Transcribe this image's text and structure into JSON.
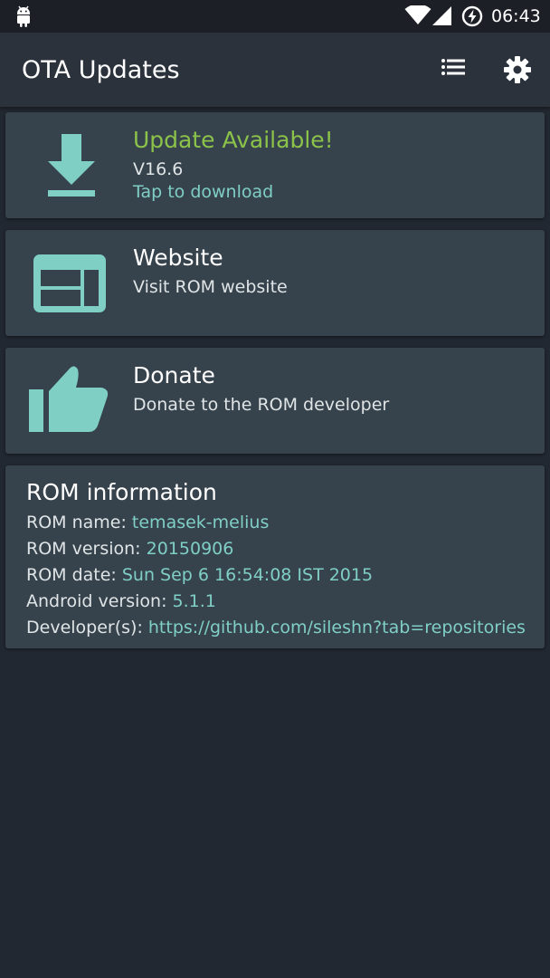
{
  "status_bar": {
    "time": "06:43",
    "icons": [
      "android-icon",
      "wifi-icon",
      "signal-icon",
      "battery-charging-icon"
    ]
  },
  "app_bar": {
    "title": "OTA Updates",
    "actions": [
      "list-icon",
      "gear-icon"
    ]
  },
  "colors": {
    "background": "#222831",
    "card": "#37434c",
    "accent_teal": "#7fcfc4",
    "update_green": "#8bc34a",
    "text_primary": "#ffffff",
    "text_secondary": "#dfe4e6"
  },
  "cards": {
    "update": {
      "icon": "download-icon",
      "title": "Update Available!",
      "version": "V16.6",
      "action": "Tap to download"
    },
    "website": {
      "icon": "web-layout-icon",
      "title": "Website",
      "subtitle": "Visit ROM website"
    },
    "donate": {
      "icon": "thumbs-up-icon",
      "title": "Donate",
      "subtitle": "Donate to the ROM developer"
    }
  },
  "rom_info": {
    "title": "ROM information",
    "rows": [
      {
        "label": "ROM name: ",
        "value": "temasek-melius"
      },
      {
        "label": "ROM version: ",
        "value": "20150906"
      },
      {
        "label": "ROM date: ",
        "value": "Sun Sep 6 16:54:08 IST 2015"
      },
      {
        "label": "Android version: ",
        "value": "5.1.1"
      },
      {
        "label": "Developer(s): ",
        "value": "https://github.com/sileshn?tab=repositories"
      }
    ]
  }
}
